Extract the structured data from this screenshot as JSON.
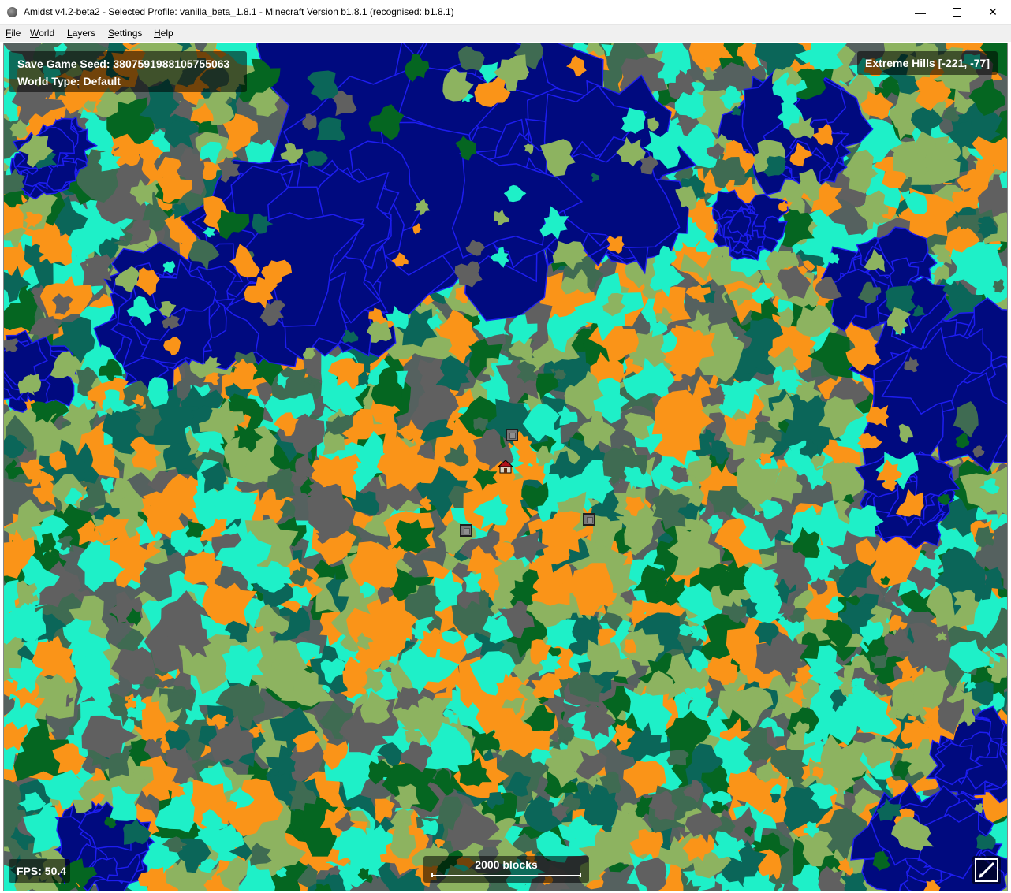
{
  "window": {
    "title": "Amidst v4.2-beta2 - Selected Profile: vanilla_beta_1.8.1 - Minecraft Version b1.8.1 (recognised: b1.8.1)",
    "icon": "amidst-app-icon",
    "controls": {
      "minimize": "—",
      "maximize": "□",
      "close": "✕"
    }
  },
  "menu": [
    "File",
    "World",
    "Layers",
    "Settings",
    "Help"
  ],
  "map": {
    "seed_text": "Save Game Seed: 3807591988105755063",
    "world_type_text": "World Type: Default",
    "biome_text": "Extreme Hills [-221, -77]",
    "fps_text": "FPS: 50.4",
    "scale_text": "2000 blocks",
    "markers": {
      "spawn": "player-spawn-icon",
      "strongholds": [
        "stronghold-icon",
        "stronghold-icon",
        "stronghold-icon"
      ]
    },
    "tool_button": "pencil-icon"
  },
  "colors": {
    "ocean": "#000a7f",
    "ocean_edge": "#1d1df0",
    "plains": "#8db360",
    "forest": "#056621",
    "taiga": "#0b6659",
    "desert": "#fa9418",
    "extreme_hills": "#606060",
    "cyan": "#1ef0c8",
    "swamp": "#3f6b52"
  }
}
